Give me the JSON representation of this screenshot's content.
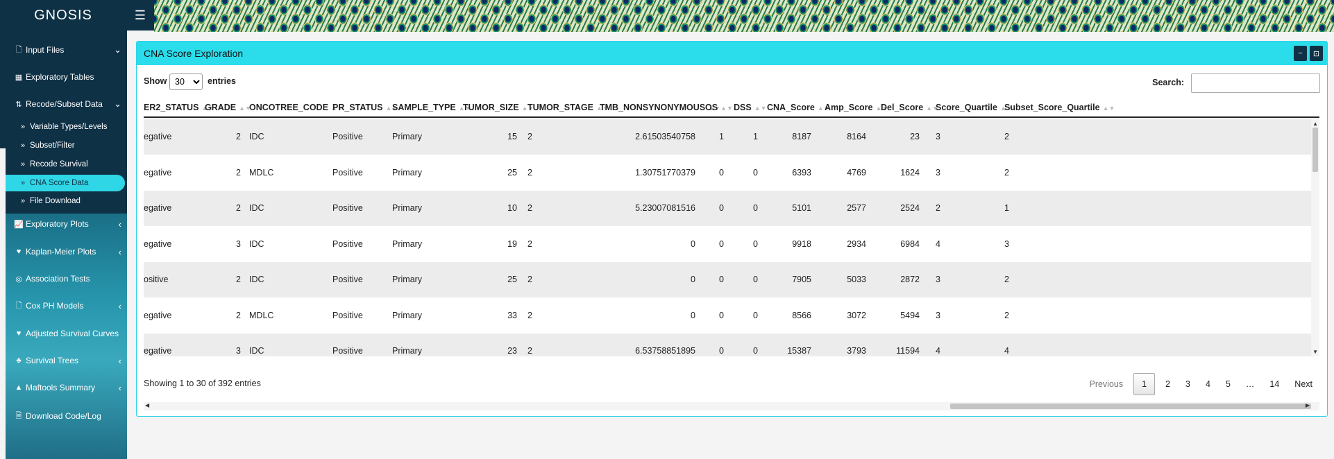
{
  "app": {
    "title": "GNOSIS",
    "menu_icon": "hamburger-icon"
  },
  "sidebar": {
    "items": [
      {
        "label": "Input Files",
        "icon": "file-icon"
      },
      {
        "label": "Exploratory Tables",
        "icon": "table-icon"
      },
      {
        "label": "Recode/Subset Data",
        "icon": "sort-icon"
      },
      {
        "label": "Variable Types/Levels",
        "icon": "double-chevron-icon"
      },
      {
        "label": "Subset/Filter",
        "icon": "double-chevron-icon"
      },
      {
        "label": "Recode Survival",
        "icon": "double-chevron-icon"
      },
      {
        "label": "CNA Score Data",
        "icon": "double-chevron-icon"
      },
      {
        "label": "File Download",
        "icon": "double-chevron-icon"
      },
      {
        "label": "Exploratory Plots",
        "icon": "chart-icon"
      },
      {
        "label": "Kaplan-Meier Plots",
        "icon": "heartbeat-icon"
      },
      {
        "label": "Association Tests",
        "icon": "network-icon"
      },
      {
        "label": "Cox PH Models",
        "icon": "file-icon"
      },
      {
        "label": "Adjusted Survival Curves",
        "icon": "heartbeat-icon"
      },
      {
        "label": "Survival Trees",
        "icon": "tree-icon"
      },
      {
        "label": "Maftools Summary",
        "icon": "warning-icon"
      },
      {
        "label": "Download Code/Log",
        "icon": "file-download-icon"
      }
    ]
  },
  "box": {
    "title": "CNA Score Exploration"
  },
  "controls": {
    "show_label": "Show",
    "page_size": "30",
    "entries_label": "entries",
    "search_label": "Search:",
    "search_value": ""
  },
  "table": {
    "columns": [
      "ER2_STATUS",
      "GRADE",
      "ONCOTREE_CODE",
      "PR_STATUS",
      "SAMPLE_TYPE",
      "TUMOR_SIZE",
      "TUMOR_STAGE",
      "TMB_NONSYNONYMOUS",
      "OS",
      "DSS",
      "CNA_Score",
      "Amp_Score",
      "Del_Score",
      "Score_Quartile",
      "Subset_Score_Quartile"
    ],
    "rows": [
      [
        "egative",
        "2",
        "IDC",
        "Positive",
        "Primary",
        "15",
        "2",
        "2.61503540758",
        "1",
        "1",
        "8187",
        "8164",
        "23",
        "3",
        "2"
      ],
      [
        "egative",
        "2",
        "MDLC",
        "Positive",
        "Primary",
        "25",
        "2",
        "1.30751770379",
        "0",
        "0",
        "6393",
        "4769",
        "1624",
        "3",
        "2"
      ],
      [
        "egative",
        "2",
        "IDC",
        "Positive",
        "Primary",
        "10",
        "2",
        "5.23007081516",
        "0",
        "0",
        "5101",
        "2577",
        "2524",
        "2",
        "1"
      ],
      [
        "egative",
        "3",
        "IDC",
        "Positive",
        "Primary",
        "19",
        "2",
        "0",
        "0",
        "0",
        "9918",
        "2934",
        "6984",
        "4",
        "3"
      ],
      [
        "ositive",
        "2",
        "IDC",
        "Positive",
        "Primary",
        "25",
        "2",
        "0",
        "0",
        "0",
        "7905",
        "5033",
        "2872",
        "3",
        "2"
      ],
      [
        "egative",
        "2",
        "MDLC",
        "Positive",
        "Primary",
        "33",
        "2",
        "0",
        "0",
        "0",
        "8566",
        "3072",
        "5494",
        "3",
        "2"
      ],
      [
        "egative",
        "3",
        "IDC",
        "Positive",
        "Primary",
        "23",
        "2",
        "6.53758851895",
        "0",
        "0",
        "15387",
        "3793",
        "11594",
        "4",
        "4"
      ]
    ]
  },
  "footer": {
    "info": "Showing 1 to 30 of 392 entries"
  },
  "pagination": {
    "previous": "Previous",
    "pages": [
      "1",
      "2",
      "3",
      "4",
      "5",
      "…",
      "14"
    ],
    "next": "Next"
  }
}
